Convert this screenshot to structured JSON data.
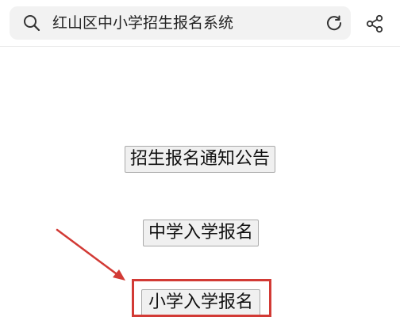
{
  "search": {
    "query": "红山区中小学招生报名系统"
  },
  "icons": {
    "search": "search-icon",
    "refresh": "refresh-icon",
    "share": "share-icon"
  },
  "buttons": {
    "notice": "招生报名通知公告",
    "middle_school": "中学入学报名",
    "primary_school": "小学入学报名"
  },
  "annotation": {
    "highlight_color": "#d23a35"
  }
}
